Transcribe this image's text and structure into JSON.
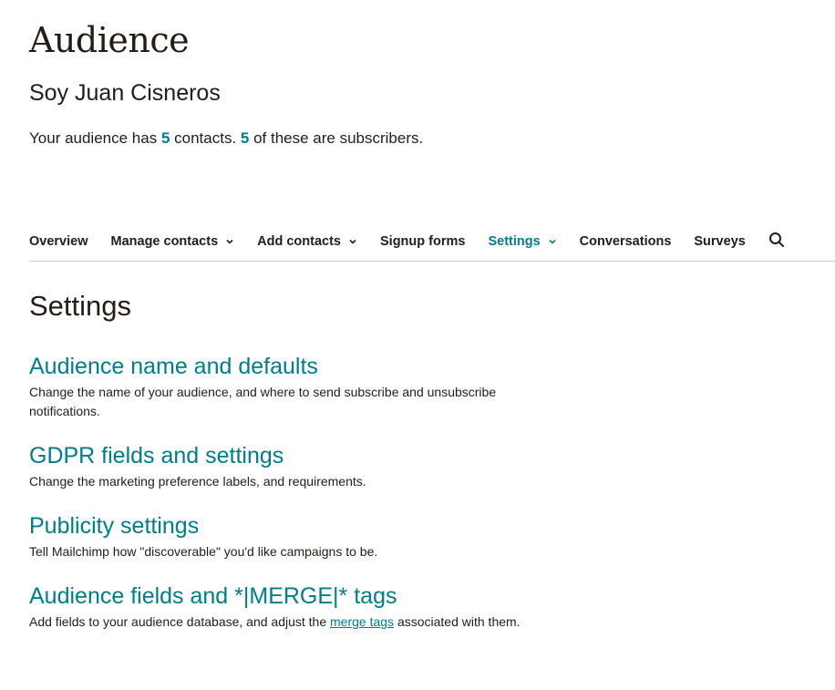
{
  "header": {
    "title": "Audience",
    "audience_name": "Soy Juan Cisneros",
    "summary": {
      "prefix": "Your audience has ",
      "contacts_count": "5",
      "middle": " contacts. ",
      "subscribers_count": "5",
      "suffix": " of these are subscribers."
    }
  },
  "nav": {
    "items": [
      {
        "label": "Overview"
      },
      {
        "label": "Manage contacts"
      },
      {
        "label": "Add contacts"
      },
      {
        "label": "Signup forms"
      },
      {
        "label": "Settings"
      },
      {
        "label": "Conversations"
      },
      {
        "label": "Surveys"
      }
    ],
    "active": "Settings"
  },
  "main": {
    "title": "Settings",
    "settings": [
      {
        "title": "Audience name and defaults",
        "description": "Change the name of your audience, and where to send subscribe and unsubscribe notifications."
      },
      {
        "title": "GDPR fields and settings",
        "description": "Change the marketing preference labels, and requirements."
      },
      {
        "title": "Publicity settings",
        "description": "Tell Mailchimp how \"discoverable\" you'd like campaigns to be."
      },
      {
        "title": "Audience fields and *|MERGE|* tags",
        "description_prefix": "Add fields to your audience database, and adjust the ",
        "description_link": "merge tags",
        "description_suffix": " associated with them."
      }
    ]
  },
  "colors": {
    "accent": "#007c89",
    "text": "#241c15",
    "divider": "#c9c9c9"
  },
  "icons": {
    "dropdown": "chevron-down-icon",
    "search": "search-icon"
  }
}
